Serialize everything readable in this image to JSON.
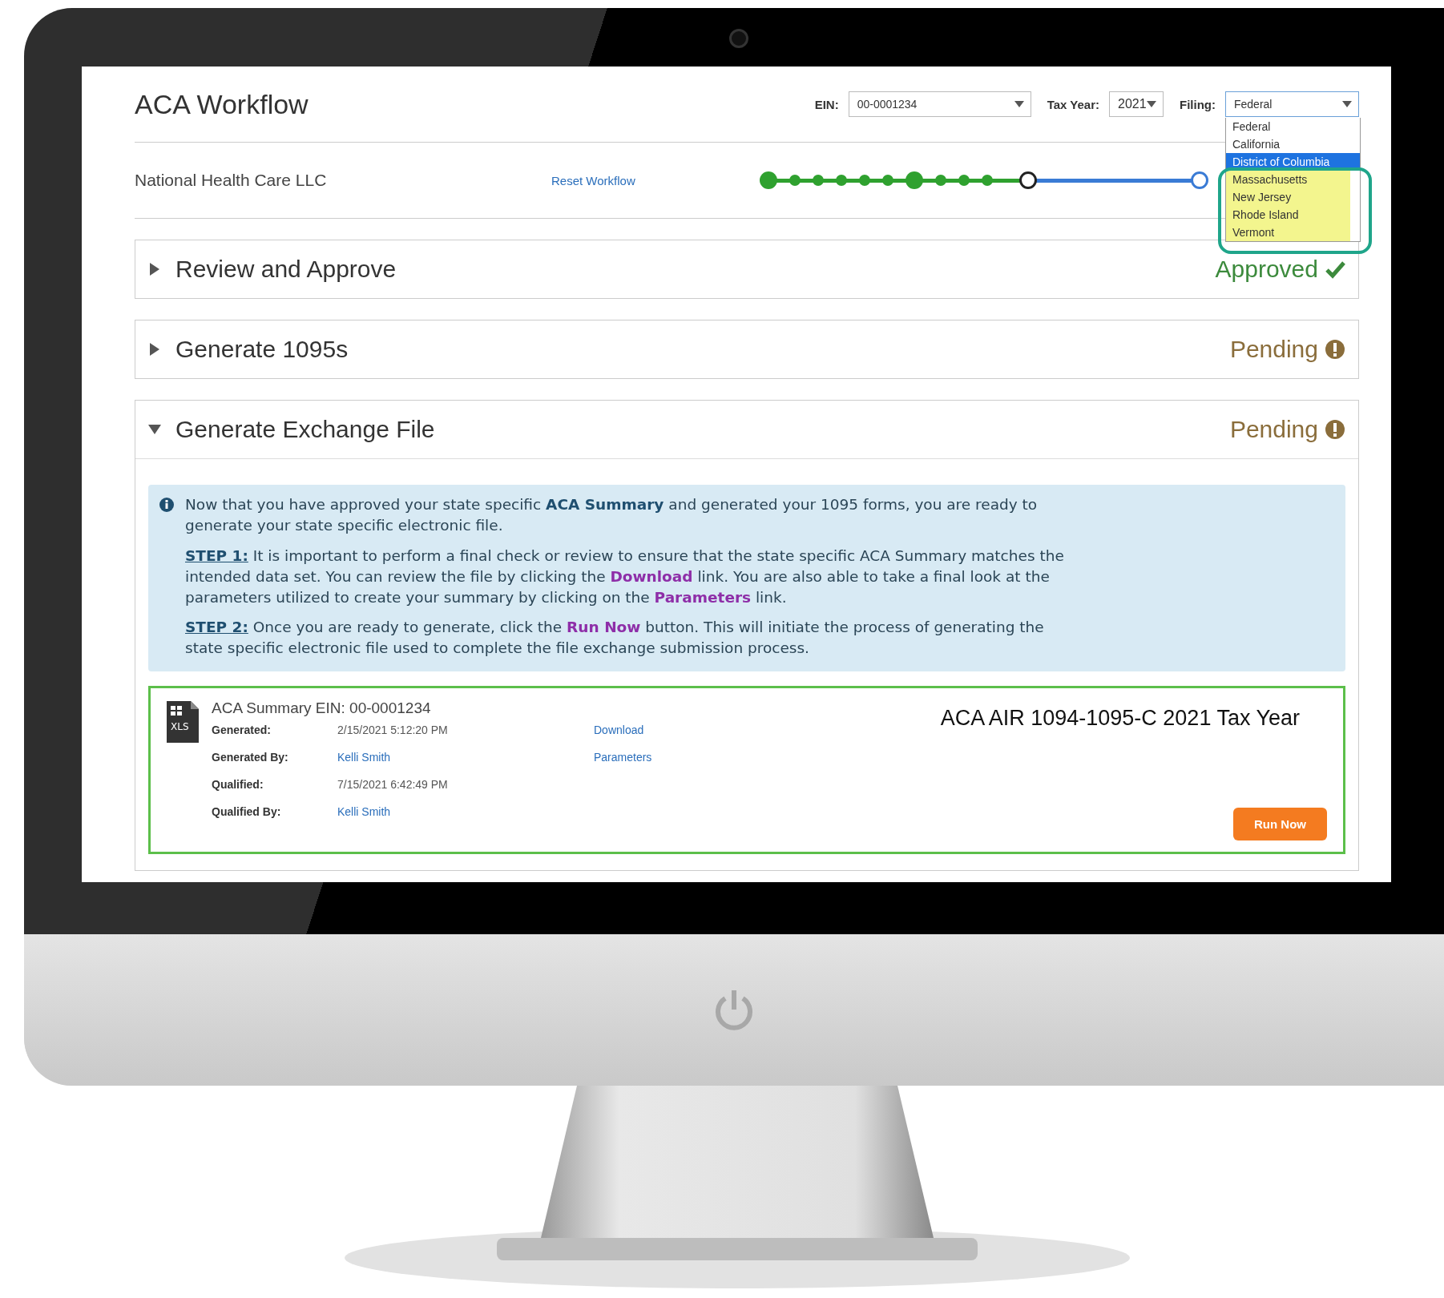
{
  "page": {
    "title": "ACA Workflow"
  },
  "filters": [
    {
      "label": "EIN:",
      "value": "00-0001234",
      "kind": "wide"
    },
    {
      "label": "Tax Year:",
      "value": "2021",
      "kind": "narrow"
    },
    {
      "label": "Filing:",
      "value": "Federal",
      "kind": "open"
    }
  ],
  "filing_options": [
    {
      "label": "Federal",
      "selected": false,
      "highlighted": false
    },
    {
      "label": "California",
      "selected": false,
      "highlighted": false
    },
    {
      "label": "District of Columbia",
      "selected": true,
      "highlighted": false
    },
    {
      "label": "Massachusetts",
      "selected": false,
      "highlighted": true
    },
    {
      "label": "New Jersey",
      "selected": false,
      "highlighted": true
    },
    {
      "label": "Rhode Island",
      "selected": false,
      "highlighted": true
    },
    {
      "label": "Vermont",
      "selected": false,
      "highlighted": true
    }
  ],
  "company": "National Health Care LLC",
  "reset_link": "Reset Workflow",
  "progress": {
    "level": 0.6,
    "steps": [
      {
        "kind": "done",
        "major": true
      },
      {
        "kind": "done",
        "major": false
      },
      {
        "kind": "done",
        "major": false
      },
      {
        "kind": "done",
        "major": false
      },
      {
        "kind": "done",
        "major": false
      },
      {
        "kind": "done",
        "major": false
      },
      {
        "kind": "done",
        "major": true
      },
      {
        "kind": "done",
        "major": false
      },
      {
        "kind": "done",
        "major": false
      },
      {
        "kind": "done",
        "major": false
      },
      {
        "kind": "current",
        "major": false
      },
      {
        "kind": "upcoming",
        "major": false
      }
    ]
  },
  "sections": [
    {
      "title": "Review and Approve",
      "expanded": false,
      "status": "Approved",
      "kind": "approved"
    },
    {
      "title": "Generate 1095s",
      "expanded": false,
      "status": "Pending",
      "kind": "pending"
    },
    {
      "title": "Generate Exchange File",
      "expanded": true,
      "status": "Pending",
      "kind": "pending"
    }
  ],
  "info": {
    "paragraphs": [
      [
        {
          "text": "Now that you have approved your state specific ",
          "kind": "plain"
        },
        {
          "text": "ACA Summary",
          "kind": "strong"
        },
        {
          "text": " and generated your 1095 forms, you are ready to generate your state specific electronic file.",
          "kind": "plain"
        }
      ],
      [
        {
          "text": "STEP 1:",
          "kind": "step"
        },
        {
          "text": " It is important to perform a final check or review to ensure that the state specific ACA Summary matches the intended data set. You can review the file by clicking the ",
          "kind": "plain"
        },
        {
          "text": "Download",
          "kind": "link"
        },
        {
          "text": " link. You are also able to take a final look at the parameters utilized to create your summary by clicking on the ",
          "kind": "plain"
        },
        {
          "text": "Parameters",
          "kind": "link"
        },
        {
          "text": " link.",
          "kind": "plain"
        }
      ],
      [
        {
          "text": "STEP 2:",
          "kind": "step"
        },
        {
          "text": " Once you are ready to generate, click the ",
          "kind": "plain"
        },
        {
          "text": "Run Now",
          "kind": "link"
        },
        {
          "text": " button. This will initiate the process of generating the state specific electronic file used to complete the file exchange submission process.",
          "kind": "plain"
        }
      ]
    ]
  },
  "summary": {
    "title": "ACA Summary EIN: 00-0001234",
    "file_type": "XLS",
    "heading": "ACA AIR 1094-1095-C 2021 Tax Year",
    "rows": [
      {
        "label": "Generated:",
        "value": "2/15/2021 5:12:20 PM",
        "value_is_link": false,
        "action": "Download"
      },
      {
        "label": "Generated By:",
        "value": "Kelli Smith",
        "value_is_link": true,
        "action": "Parameters"
      },
      {
        "label": "Qualified:",
        "value": "7/15/2021 6:42:49 PM",
        "value_is_link": false
      },
      {
        "label": "Qualified By:",
        "value": "Kelli Smith",
        "value_is_link": true
      }
    ],
    "button": "Run Now"
  }
}
